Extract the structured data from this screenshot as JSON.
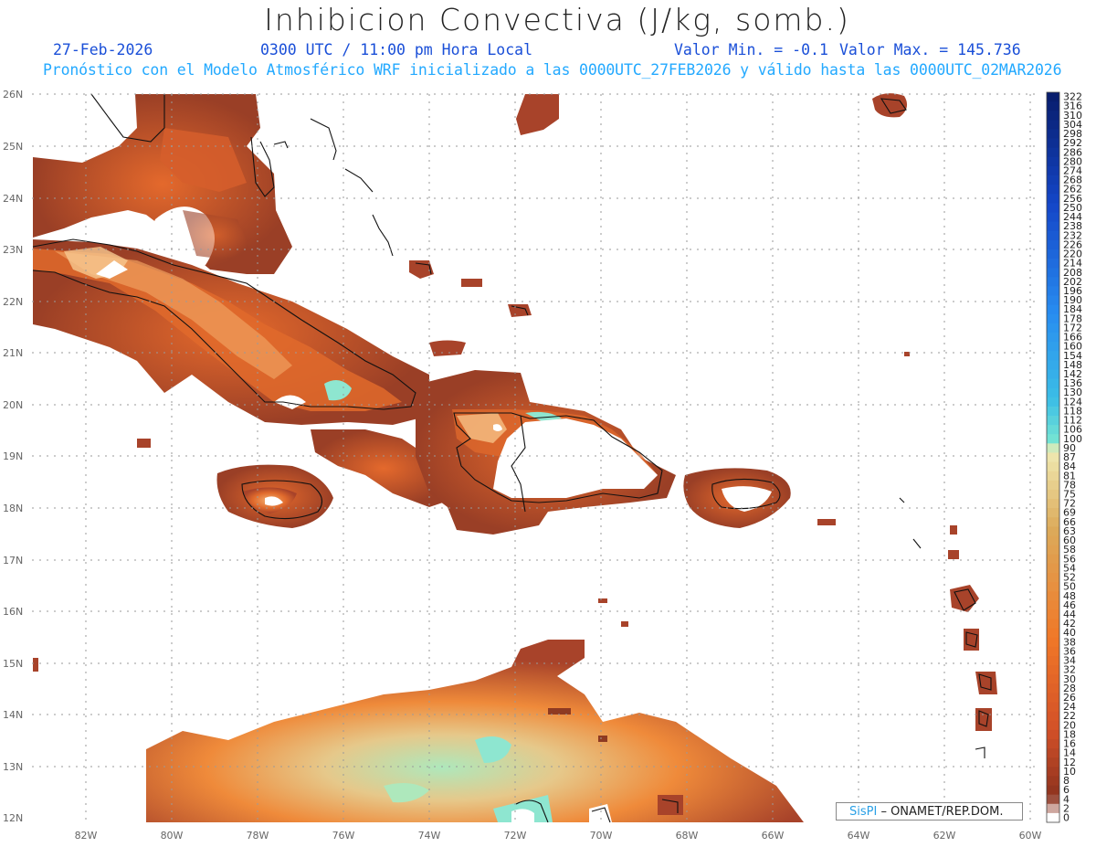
{
  "title": "Inhibicion Convectiva (J/kg, somb.)",
  "header": {
    "date": "27-Feb-2026",
    "time": "0300 UTC / 11:00 pm Hora Local",
    "vmin": "Valor Min. = -0.1",
    "vmax": "Valor Max. = 145.736",
    "forecast": "Pronóstico con el Modelo Atmosférico WRF inicializado a las 0000UTC_27FEB2026 y válido hasta las  0000UTC_02MAR2026"
  },
  "axes": {
    "lat_labels": [
      "26N",
      "25N",
      "24N",
      "23N",
      "22N",
      "21N",
      "20N",
      "19N",
      "18N",
      "17N",
      "16N",
      "15N",
      "14N",
      "13N",
      "12N"
    ],
    "lon_labels": [
      "82W",
      "80W",
      "78W",
      "76W",
      "74W",
      "72W",
      "70W",
      "68W",
      "66W",
      "64W",
      "62W",
      "60W"
    ]
  },
  "colorbar": {
    "labels": [
      "322",
      "316",
      "310",
      "304",
      "298",
      "292",
      "286",
      "280",
      "274",
      "268",
      "262",
      "256",
      "250",
      "244",
      "238",
      "232",
      "226",
      "220",
      "214",
      "208",
      "202",
      "196",
      "190",
      "184",
      "178",
      "172",
      "166",
      "160",
      "154",
      "148",
      "142",
      "136",
      "130",
      "124",
      "118",
      "112",
      "106",
      "100",
      "90",
      "87",
      "84",
      "81",
      "78",
      "75",
      "72",
      "69",
      "66",
      "63",
      "60",
      "58",
      "56",
      "54",
      "52",
      "50",
      "48",
      "46",
      "44",
      "42",
      "40",
      "38",
      "36",
      "34",
      "32",
      "30",
      "28",
      "26",
      "24",
      "22",
      "20",
      "18",
      "16",
      "14",
      "12",
      "10",
      "8",
      "6",
      "4",
      "2",
      "0"
    ]
  },
  "credit": {
    "logo": "SisPI",
    "text": " – ONAMET/REP.DOM."
  },
  "colors": {
    "land_low": "#8e3a22",
    "land_mid": "#c8542a",
    "land_high": "#f08a34",
    "cyan": "#7fe6d2",
    "coast": "#111111"
  }
}
